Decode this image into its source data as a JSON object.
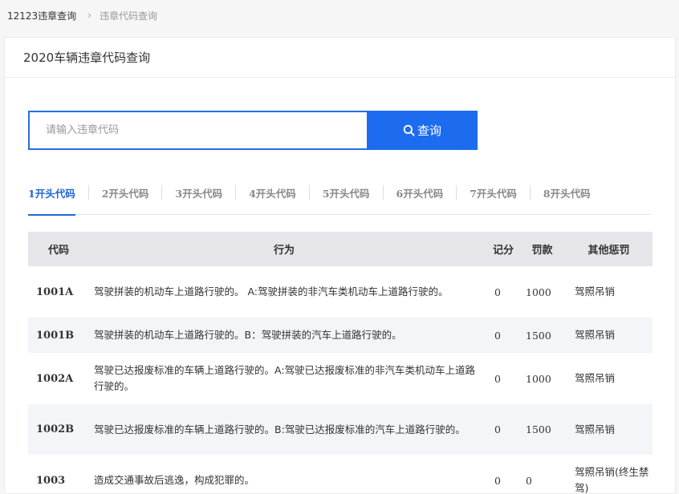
{
  "breadcrumb": {
    "home": "12123违章查询",
    "separator": "›",
    "current": "违章代码查询"
  },
  "page_title": "2020车辆违章代码查询",
  "search": {
    "placeholder": "请输入违章代码",
    "button_label": "查询",
    "button_icon": "search-icon",
    "accent": "#1d6cf0"
  },
  "tabs": [
    {
      "label": "1开头代码",
      "active": true
    },
    {
      "label": "2开头代码",
      "active": false
    },
    {
      "label": "3开头代码",
      "active": false
    },
    {
      "label": "4开头代码",
      "active": false
    },
    {
      "label": "5开头代码",
      "active": false
    },
    {
      "label": "6开头代码",
      "active": false
    },
    {
      "label": "7开头代码",
      "active": false
    },
    {
      "label": "8开头代码",
      "active": false
    }
  ],
  "table": {
    "headers": {
      "code": "代码",
      "action": "行为",
      "points": "记分",
      "fine": "罚款",
      "other": "其他惩罚"
    },
    "rows": [
      {
        "code": "1001A",
        "action": "驾驶拼装的机动车上道路行驶的。 A:驾驶拼装的非汽车类机动车上道路行驶的。",
        "points": "0",
        "fine": "1000",
        "other": "驾照吊销"
      },
      {
        "code": "1001B",
        "action": "驾驶拼装的机动车上道路行驶的。B：驾驶拼装的汽车上道路行驶的。",
        "points": "0",
        "fine": "1500",
        "other": "驾照吊销"
      },
      {
        "code": "1002A",
        "action": "驾驶已达报废标准的车辆上道路行驶的。A:驾驶已达报废标准的非汽车类机动车上道路行驶的。",
        "points": "0",
        "fine": "1000",
        "other": "驾照吊销"
      },
      {
        "code": "1002B",
        "action": "驾驶已达报废标准的车辆上道路行驶的。B:驾驶已达报废标准的汽车上道路行驶的。",
        "points": "0",
        "fine": "1500",
        "other": "驾照吊销"
      },
      {
        "code": "1003",
        "action": "造成交通事故后逃逸，构成犯罪的。",
        "points": "0",
        "fine": "0",
        "other": "驾照吊销(终生禁驾)"
      }
    ]
  }
}
